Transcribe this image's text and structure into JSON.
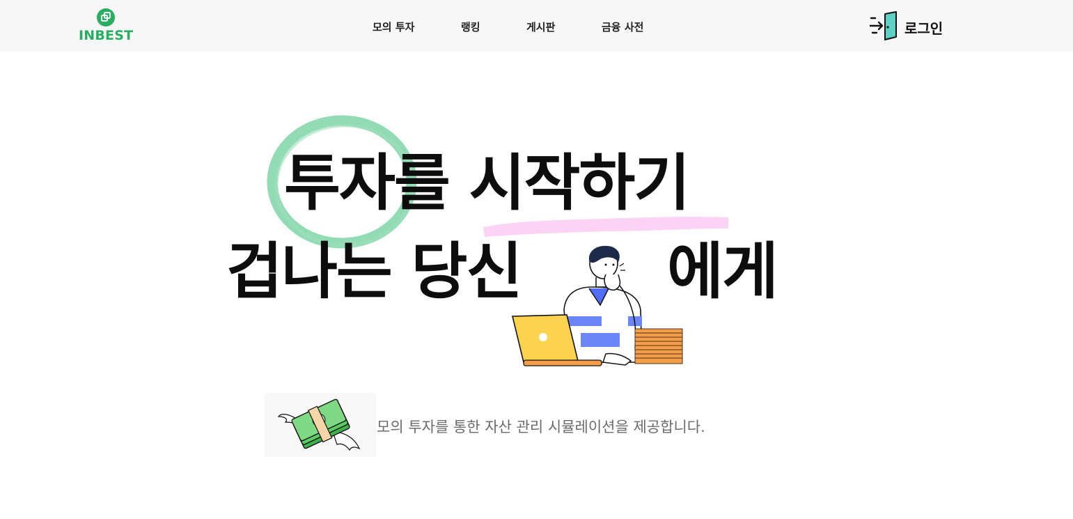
{
  "header": {
    "logo_text": "INBEST",
    "nav": [
      {
        "label": "모의 투자"
      },
      {
        "label": "랭킹"
      },
      {
        "label": "게시판"
      },
      {
        "label": "금융 사전"
      }
    ],
    "login_label": "로그인"
  },
  "hero": {
    "line1": "투자를 시작하기",
    "line2_left": "겁나는 당신",
    "line2_right": "에게"
  },
  "subtitle": "모의 투자를 통한 자산 관리 시뮬레이션을 제공합니다.",
  "colors": {
    "brand_green": "#27ae60",
    "circle_green": "#7fd6a8",
    "brush_pink": "#fcd3f4",
    "header_bg": "#f7f7f7",
    "subtitle_gray": "#6b6b6b"
  },
  "icons": [
    "inbest-logo-icon",
    "login-door-icon",
    "flying-money-icon"
  ]
}
